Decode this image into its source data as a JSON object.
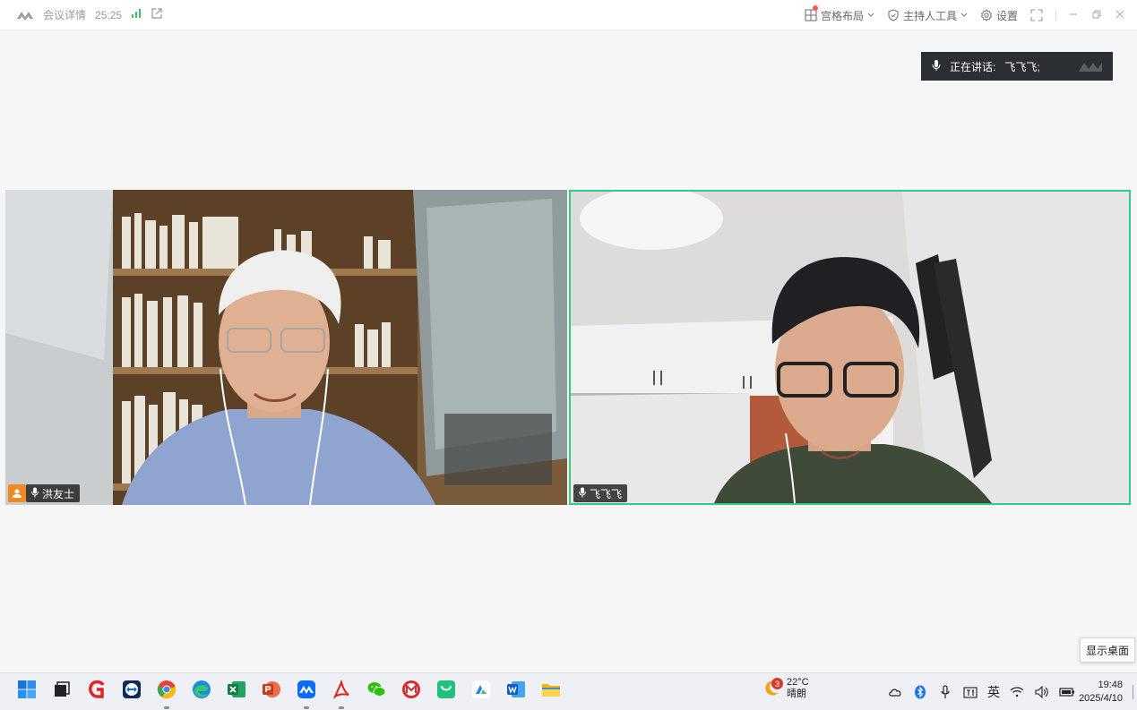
{
  "titlebar": {
    "meeting_details": "会议详情",
    "duration": "25:25",
    "layout_label": "宫格布局",
    "host_tools_label": "主持人工具",
    "settings_label": "设置"
  },
  "speaking": {
    "prefix": "正在讲话:",
    "name": "飞飞飞;"
  },
  "participants": [
    {
      "name": "洪友士",
      "is_host": true
    },
    {
      "name": "飞飞飞",
      "is_host": false,
      "active_speaker": true
    }
  ],
  "tooltip": {
    "show_desktop": "显示桌面"
  },
  "taskbar": {
    "weather_temp": "22°C",
    "weather_desc": "晴朗",
    "weather_badge": "3",
    "ime": "英",
    "time": "19:48",
    "date": "2025/4/10"
  },
  "colors": {
    "active_border": "#2ecc85",
    "host_badge": "#f08a24",
    "signal": "#3dbb6c"
  }
}
